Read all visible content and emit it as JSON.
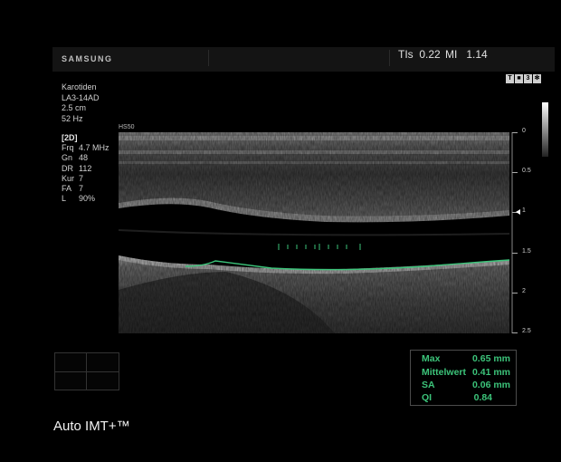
{
  "header": {
    "brand": "SAMSUNG",
    "tis": "TIs  0.22",
    "mi": "MI   1.14"
  },
  "exam_info": {
    "preset": "Karotiden",
    "probe": "LA3-14AD",
    "depth": "2.5 cm",
    "frame_rate": "52 Hz"
  },
  "imaging_params": {
    "mode": "[2D]",
    "rows": [
      {
        "key": "Frq",
        "value": "4.7 MHz"
      },
      {
        "key": "Gn",
        "value": "48"
      },
      {
        "key": "DR",
        "value": "112"
      },
      {
        "key": "Kur",
        "value": "7"
      },
      {
        "key": "FA",
        "value": "7"
      },
      {
        "key": "L",
        "value": "90%"
      }
    ]
  },
  "image_label": "HS50",
  "depth_scale": [
    "0",
    "0.5",
    "1",
    "1.5",
    "2",
    "2.5"
  ],
  "status_icons": [
    "T",
    "■",
    "3",
    "✻"
  ],
  "function_name": "Auto IMT+™",
  "measurements": [
    {
      "label": "Max",
      "value": "0.65 mm"
    },
    {
      "label": "Mittelwert",
      "value": "0.41 mm"
    },
    {
      "label": "SA",
      "value": "0.06 mm"
    },
    {
      "label": "QI",
      "value": "0.84"
    }
  ],
  "colors": {
    "measurement": "#3cc47a",
    "trace": "#3cc47a",
    "background": "#000000"
  }
}
